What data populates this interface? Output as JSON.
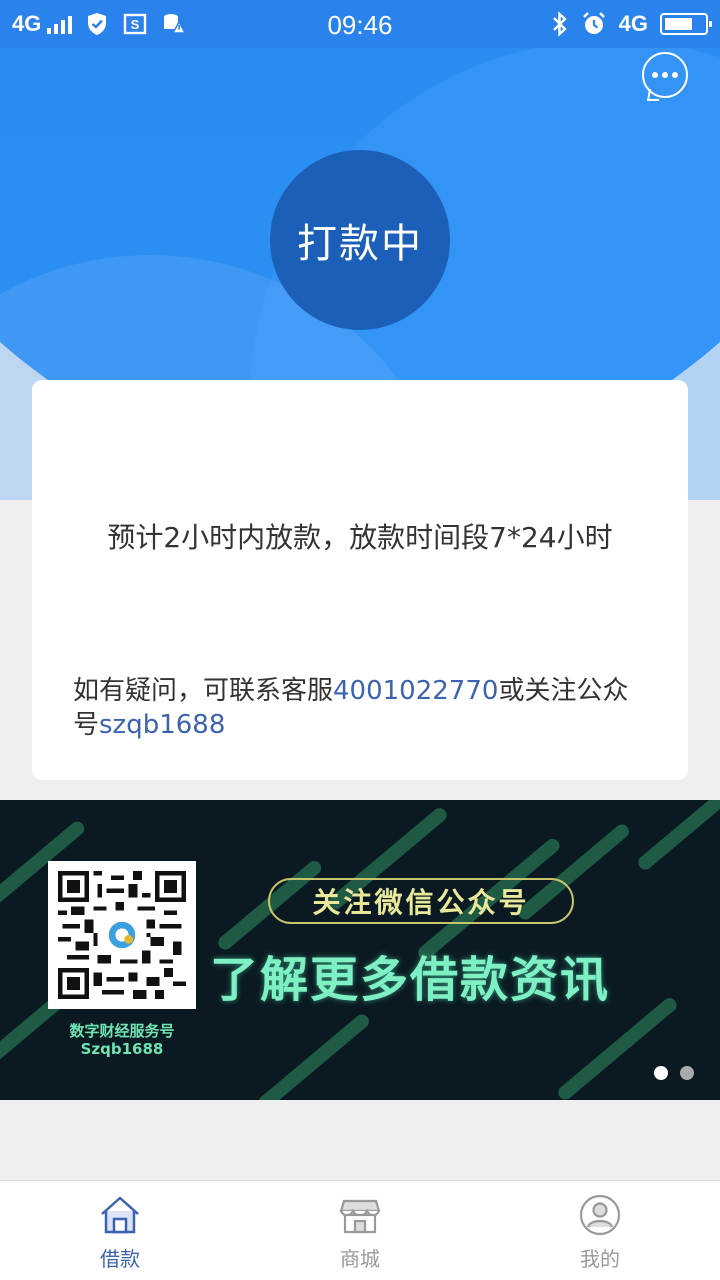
{
  "status_bar": {
    "network_left": "4G",
    "time": "09:46",
    "network_right": "4G",
    "icons": [
      "signal-icon",
      "shield-icon",
      "screenshot-icon",
      "data-warning-icon",
      "bluetooth-icon",
      "alarm-icon",
      "battery-icon"
    ]
  },
  "header": {
    "menu_icon": "more-chat-icon",
    "status_label": "打款中"
  },
  "card": {
    "eta_text": "预计2小时内放款，放款时间段7*24小时",
    "contact_prefix": "如有疑问，可联系客服",
    "phone": "4001022770",
    "contact_middle": "或关注公众号",
    "wechat_id": "szqb1688"
  },
  "banner": {
    "tag": "关注微信公众号",
    "headline": "了解更多借款资讯",
    "qr_caption_line1": "数字财经服务号",
    "qr_caption_line2": "Szqb1688",
    "active_dot": 0,
    "dot_count": 2
  },
  "tabbar": {
    "tabs": [
      {
        "label": "借款",
        "icon": "home-icon",
        "active": true
      },
      {
        "label": "商城",
        "icon": "shop-icon",
        "active": false
      },
      {
        "label": "我的",
        "icon": "profile-icon",
        "active": false
      }
    ]
  },
  "colors": {
    "primary_blue": "#2a86f0",
    "status_circle": "#1b5fb8",
    "link": "#3d63b0",
    "banner_bg": "#0b1a22",
    "banner_text": "#7ef0c4"
  }
}
